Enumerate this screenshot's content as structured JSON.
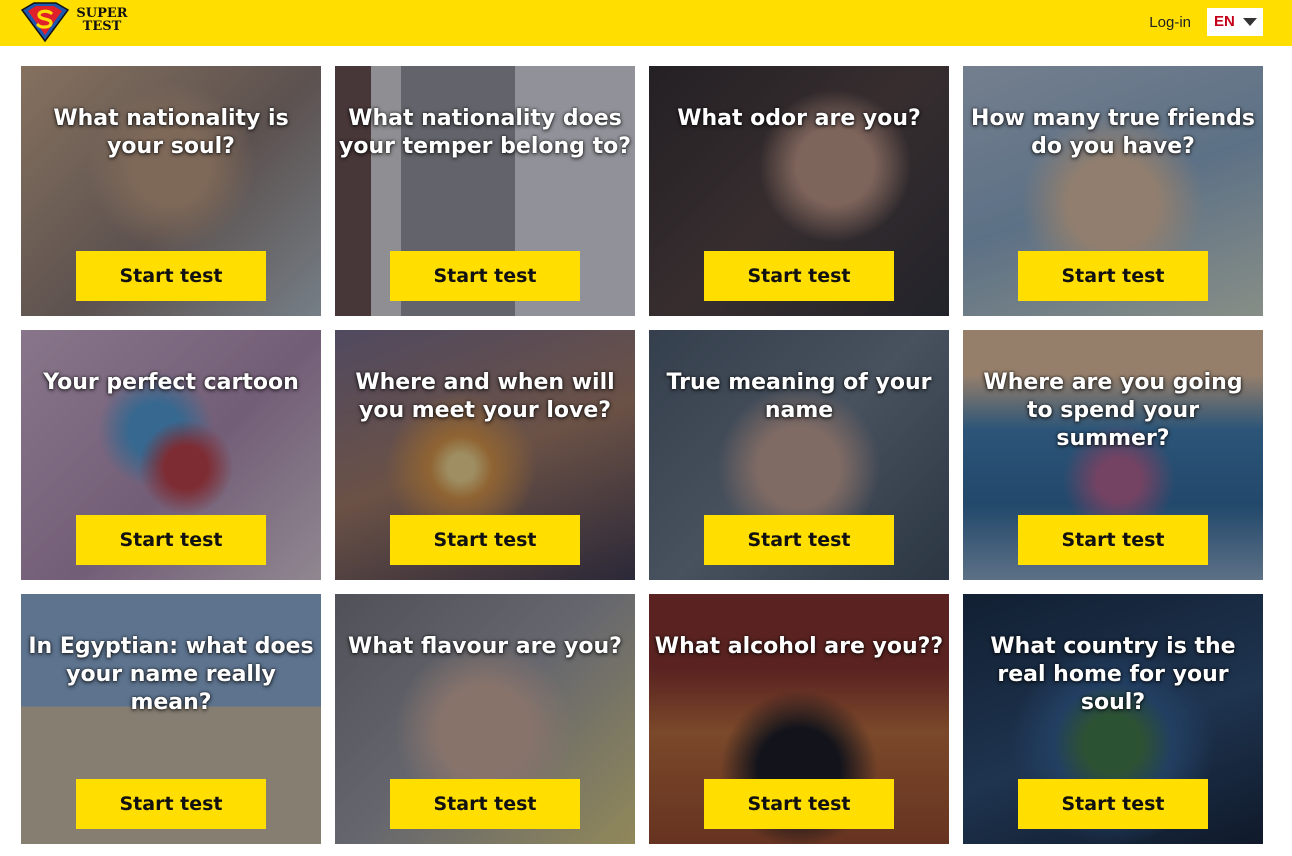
{
  "header": {
    "logo_line1": "SUPER",
    "logo_line2": "TEST",
    "login_label": "Log-in",
    "language_code": "EN",
    "background_color": "#ffde00"
  },
  "tests": [
    {
      "title": "What nationality is your soul?",
      "button_label": "Start test"
    },
    {
      "title": "What nationality does your temper belong to?",
      "button_label": "Start test"
    },
    {
      "title": "What odor are you?",
      "button_label": "Start test"
    },
    {
      "title": "How many true friends do you have?",
      "button_label": "Start test"
    },
    {
      "title": "Your perfect cartoon",
      "button_label": "Start test"
    },
    {
      "title": "Where and when will you meet your love?",
      "button_label": "Start test"
    },
    {
      "title": "True meaning of your name",
      "button_label": "Start test"
    },
    {
      "title": "Where are you going to spend your summer?",
      "button_label": "Start test"
    },
    {
      "title": "In Egyptian: what does your name really mean?",
      "button_label": "Start test"
    },
    {
      "title": "What flavour are you?",
      "button_label": "Start test"
    },
    {
      "title": "What alcohol are you??",
      "button_label": "Start test"
    },
    {
      "title": "What country is the real home for your soul?",
      "button_label": "Start test"
    }
  ],
  "colors": {
    "accent": "#ffde00",
    "language_text": "#c4001a"
  }
}
